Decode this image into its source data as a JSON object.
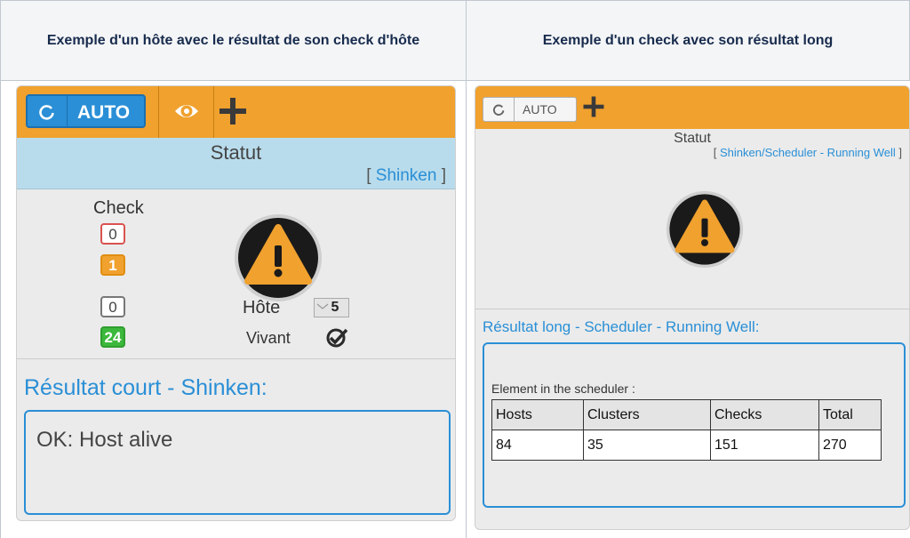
{
  "header": {
    "left": "Exemple d'un hôte avec le résultat de son check d'hôte",
    "right": "Exemple d'un check avec son résultat long"
  },
  "left_panel": {
    "auto_label": "AUTO",
    "status_title": "Statut",
    "status_link_open": "[ ",
    "status_link": "Shinken",
    "status_link_close": " ]",
    "check_label": "Check",
    "check_counts": [
      "0",
      "1",
      "0",
      "24"
    ],
    "host_label": "Hôte",
    "host_count": "5",
    "alive_label": "Vivant",
    "result_title": "Résultat court - Shinken:",
    "result_text": "OK: Host alive",
    "colors": {
      "toolbar": "#f0a12e",
      "accent": "#2a8fd6",
      "status_band": "#b9dcec"
    }
  },
  "right_panel": {
    "auto_label": "AUTO",
    "status_title": "Statut",
    "status_link_open": "[ ",
    "status_link": "Shinken/Scheduler - Running Well",
    "status_link_close": " ]",
    "result_title": "Résultat long - Scheduler - Running Well:",
    "element_label": "Element in the scheduler :",
    "table": {
      "headers": [
        "Hosts",
        "Clusters",
        "Checks",
        "Total"
      ],
      "row": [
        "84",
        "35",
        "151",
        "270"
      ]
    }
  }
}
